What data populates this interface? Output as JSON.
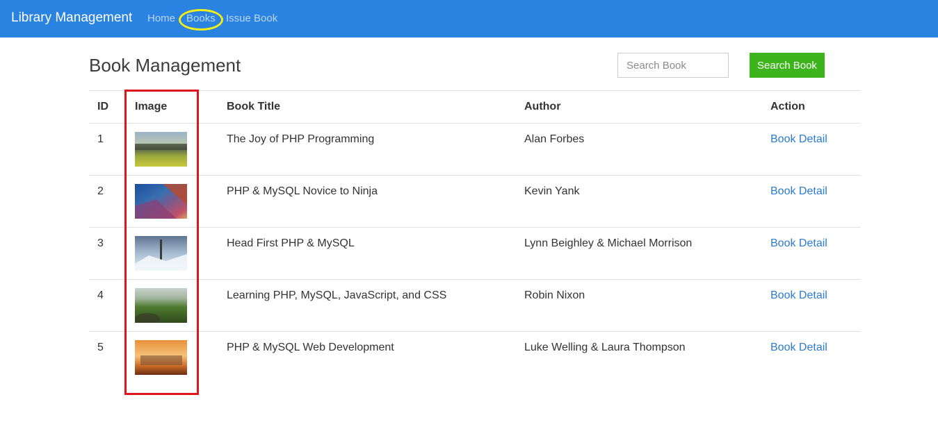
{
  "navbar": {
    "brand": "Library Management",
    "links": [
      {
        "label": "Home"
      },
      {
        "label": "Books"
      },
      {
        "label": "Issue Book"
      }
    ]
  },
  "page": {
    "title": "Book Management",
    "search_placeholder": "Search Book",
    "search_button": "Search Book"
  },
  "table": {
    "headers": [
      "ID",
      "Image",
      "Book Title",
      "Author",
      "Action"
    ],
    "rows": [
      {
        "id": "1",
        "thumbnail": "savanna-herd-image",
        "title": "The Joy of PHP Programming",
        "author": "Alan Forbes",
        "action": "Book Detail"
      },
      {
        "id": "2",
        "thumbnail": "flower-field-mountains-image",
        "title": "PHP & MySQL Novice to Ninja",
        "author": "Kevin Yank",
        "action": "Book Detail"
      },
      {
        "id": "3",
        "thumbnail": "icy-landscape-tree-image",
        "title": "Head First PHP & MySQL",
        "author": "Lynn Beighley & Michael Morrison",
        "action": "Book Detail"
      },
      {
        "id": "4",
        "thumbnail": "green-valley-image",
        "title": "Learning PHP, MySQL, JavaScript, and CSS",
        "author": "Robin Nixon",
        "action": "Book Detail"
      },
      {
        "id": "5",
        "thumbnail": "sunset-zebras-image",
        "title": "PHP & MySQL Web Development",
        "author": "Luke Welling & Laura Thompson",
        "action": "Book Detail"
      }
    ]
  },
  "colors": {
    "navbar": "#2a83e0",
    "search_button": "#3db31c",
    "link": "#2a7bd4",
    "highlight_ellipse": "#f2ee16",
    "highlight_box": "#e0141b"
  }
}
